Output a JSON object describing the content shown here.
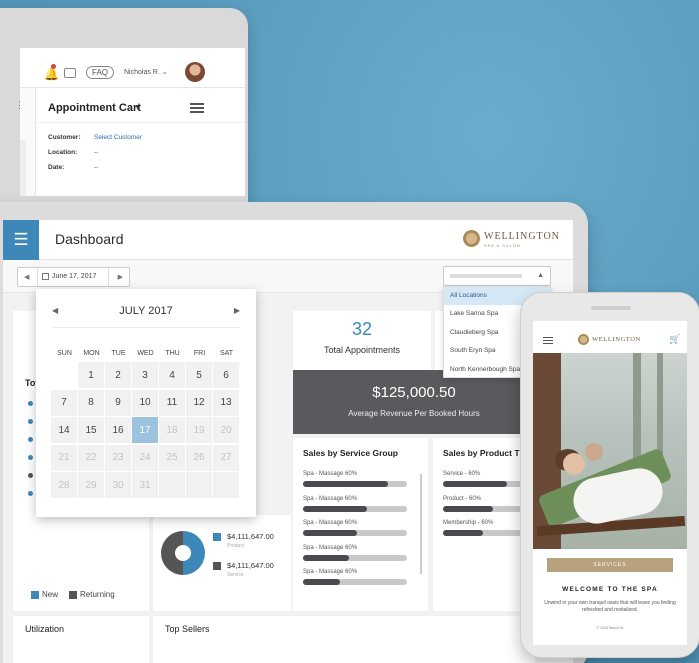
{
  "back_tablet": {
    "faq_label": "FAQ",
    "user_name": "Nicholas R.",
    "cart_title": "Appointment Cart",
    "rows": [
      {
        "label": "Customer:",
        "value": "Select Customer"
      },
      {
        "label": "Location:",
        "value": "--"
      },
      {
        "label": "Date:",
        "value": "--"
      }
    ]
  },
  "dashboard": {
    "title": "Dashboard",
    "brand": "WELLINGTON",
    "brand_sub": "SPA & SALON",
    "date_value": "June 17, 2017",
    "location_options": [
      "All Locations",
      "Lake Sarina Spa",
      "Claudieberg Spa",
      "South Eryn Spa",
      "North Kennerbough Spa"
    ],
    "selected_location_index": 0,
    "kpi": {
      "value": "32",
      "label": "Total Appointments"
    },
    "revenue": {
      "value": "$125,000.50",
      "label": "Average Revenue Per Booked Hours"
    },
    "left_card_title": "Toy",
    "legend": {
      "new": "New",
      "returning": "Returning"
    },
    "donut": {
      "items": [
        {
          "value": "$4,111,647.00",
          "sub": "Product",
          "color": "#3d88b8"
        },
        {
          "value": "$4,111,647.00",
          "sub": "Service",
          "color": "#555555"
        }
      ]
    },
    "service_group": {
      "title": "Sales by Service Group",
      "items": [
        {
          "label": "Spa - Massage 60%",
          "pct": 0.82
        },
        {
          "label": "Spa - Massage 60%",
          "pct": 0.62
        },
        {
          "label": "Spa - Massage 60%",
          "pct": 0.52
        },
        {
          "label": "Spa - Massage 60%",
          "pct": 0.44
        },
        {
          "label": "Spa - Massage 60%",
          "pct": 0.36
        }
      ]
    },
    "product": {
      "title": "Sales by Product T",
      "items": [
        {
          "label": "Service - 60%",
          "pct": 0.8
        },
        {
          "label": "Product - 60%",
          "pct": 0.62
        },
        {
          "label": "Membership - 60%",
          "pct": 0.5
        }
      ]
    },
    "utilization_title": "Utilization",
    "top_sellers_title": "Top Sellers",
    "colors": {
      "accent": "#3d88b8",
      "dark": "#4b4b4f"
    }
  },
  "calendar": {
    "month_label": "JULY 2017",
    "weekdays": [
      "SUN",
      "MON",
      "TUE",
      "WED",
      "THU",
      "FRI",
      "SAT"
    ],
    "weeks": [
      [
        "",
        "1",
        "2",
        "3",
        "4",
        "5",
        "6"
      ],
      [
        "7",
        "8",
        "9",
        "10",
        "11",
        "12",
        "13"
      ],
      [
        "14",
        "15",
        "16",
        "17",
        "18",
        "19",
        "20"
      ],
      [
        "21",
        "22",
        "23",
        "24",
        "25",
        "26",
        "27"
      ],
      [
        "28",
        "29",
        "30",
        "31",
        "",
        "",
        ""
      ]
    ],
    "selected_day": "17",
    "first_dimmed_day": 18
  },
  "phone": {
    "brand": "WELLINGTON",
    "button_label": "SERVICES",
    "welcome": "WELCOME TO THE SPA",
    "body": "Unwind in your own tranquil oasis that will leave you feeling refreshed and revitalized.",
    "copyright": "© 2018 SalonTrix"
  }
}
